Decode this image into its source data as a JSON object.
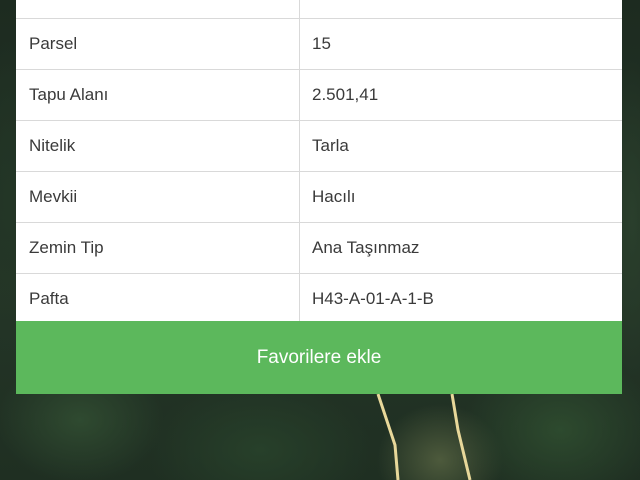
{
  "table": {
    "rows": [
      {
        "label": "",
        "value": ""
      },
      {
        "label": "Parsel",
        "value": "15"
      },
      {
        "label": "Tapu Alanı",
        "value": "2.501,41"
      },
      {
        "label": "Nitelik",
        "value": "Tarla"
      },
      {
        "label": "Mevkii",
        "value": "Hacılı"
      },
      {
        "label": "Zemin Tip",
        "value": "Ana Taşınmaz"
      },
      {
        "label": "Pafta",
        "value": "H43-A-01-A-1-B"
      }
    ]
  },
  "favorite_button": {
    "label": "Favorilere ekle"
  },
  "colors": {
    "button": "#5cb85c",
    "parcel_outline": "#e8d89a"
  }
}
